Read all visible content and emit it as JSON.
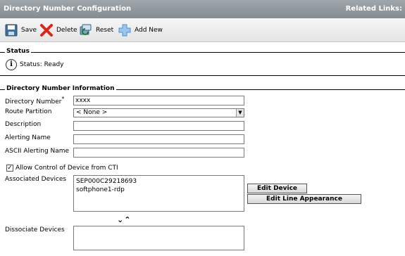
{
  "header": {
    "title": "Directory Number Configuration",
    "related_links": "Related Links:"
  },
  "toolbar": {
    "save": "Save",
    "delete": "Delete",
    "reset": "Reset",
    "add_new": "Add New"
  },
  "status": {
    "legend": "Status",
    "text": "Status: Ready"
  },
  "dn_info": {
    "legend": "Directory Number Information",
    "directory_number_label": "Directory Number",
    "required_mark": "*",
    "directory_number_value": "xxxx",
    "route_partition_label": "Route Partition",
    "route_partition_value": "< None >",
    "description_label": "Description",
    "description_value": "",
    "alerting_name_label": "Alerting Name",
    "alerting_name_value": "",
    "ascii_alerting_name_label": "ASCII Alerting Name",
    "ascii_alerting_name_value": "",
    "allow_cti_label": "Allow Control of Device from CTI",
    "allow_cti_checked": "✓",
    "associated_devices_label": "Associated Devices",
    "associated_devices": [
      "SEP000C29218693",
      "softphone1-rdp"
    ],
    "edit_device_button": "Edit Device",
    "edit_line_appearance_button": "Edit Line Appearance",
    "move_arrows": "⌄⌃",
    "dissociate_devices_label": "Dissociate Devices"
  },
  "icons": {
    "save": "floppy-disk-icon",
    "delete": "red-x-icon",
    "reset": "reset-icon",
    "add_new": "plus-icon",
    "info": "info-icon"
  },
  "colors": {
    "title_bar": "#8f979d",
    "delete_red": "#d8281c",
    "add_blue": "#4a8fd8"
  }
}
